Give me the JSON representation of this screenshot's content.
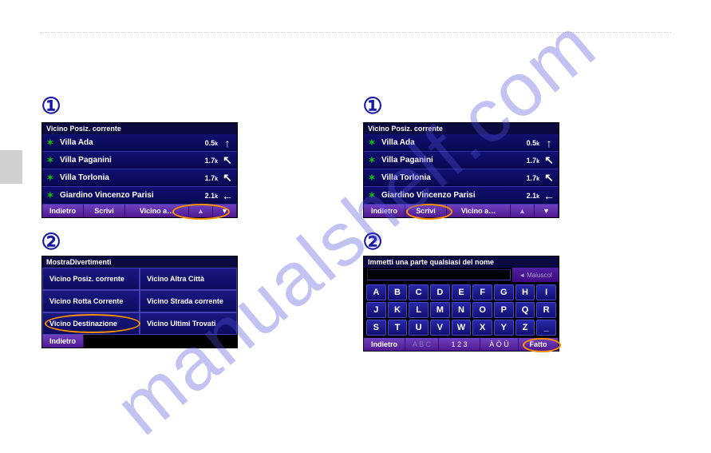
{
  "watermark": "manualshelf.com",
  "badges": {
    "one": "①",
    "two": "②"
  },
  "listScreen": {
    "title": "Vicino Posiz. corrente",
    "rows": [
      {
        "name": "Villa Ada",
        "dist": "0.5",
        "unit": "k",
        "arrow": "↑"
      },
      {
        "name": "Villa Paganini",
        "dist": "1.7",
        "unit": "k",
        "arrow": "↖"
      },
      {
        "name": "Villa Torlonia",
        "dist": "1.7",
        "unit": "k",
        "arrow": "↖"
      },
      {
        "name": "Giardino Vincenzo Parisi",
        "dist": "2.1",
        "unit": "k",
        "arrow": "←"
      }
    ],
    "footer": {
      "back": "Indietro",
      "write": "Scrivi",
      "near": "Vicino a…",
      "up": "▲",
      "down": "▼"
    }
  },
  "optionsScreen": {
    "title": "MostraDivertimenti",
    "cells": [
      "Vicino Posiz. corrente",
      "Vicino Altra Città",
      "Vicino Rotta Corrente",
      "Vicino Strada corrente",
      "Vicino Destinazione",
      "Vicino Ultimi Trovati"
    ],
    "back": "Indietro"
  },
  "keyboardScreen": {
    "title": "Immetti una parte qualsiasi del nome",
    "caps": "Maiuscol",
    "capsArrow": "◄",
    "keys": [
      "A",
      "B",
      "C",
      "D",
      "E",
      "F",
      "G",
      "H",
      "I",
      "J",
      "K",
      "L",
      "M",
      "N",
      "O",
      "P",
      "Q",
      "R",
      "S",
      "T",
      "U",
      "V",
      "W",
      "X",
      "Y",
      "Z",
      "_"
    ],
    "footer": {
      "back": "Indietro",
      "abc": "A B C",
      "num": "1 2 3",
      "acc": "À Ò Ù",
      "done": "Fatto"
    }
  }
}
